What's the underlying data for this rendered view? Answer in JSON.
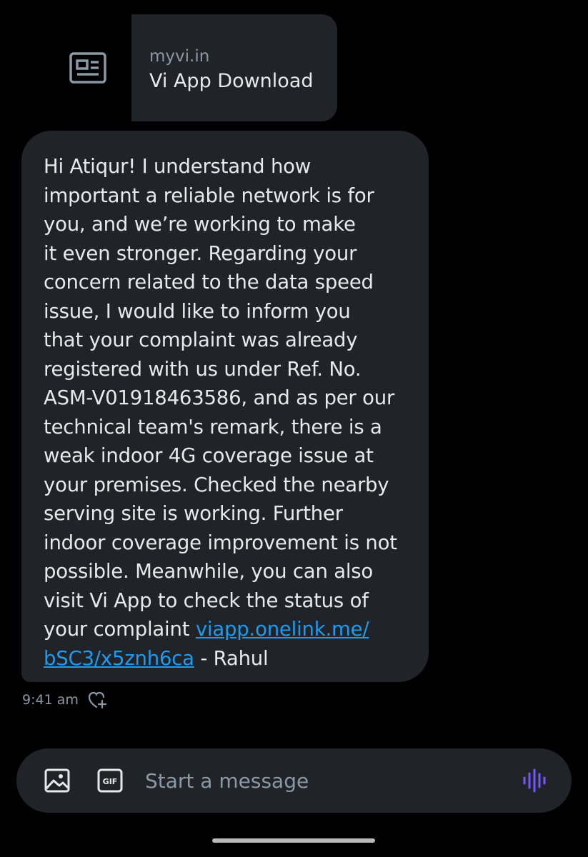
{
  "link_preview": {
    "domain": "myvi.in",
    "title": "Vi App Download",
    "icon": "article-icon"
  },
  "message": {
    "text_before_link": "Hi Atiqur! I understand how\nimportant a reliable network is for\nyou, and we’re working to make\nit even stronger. Regarding your\nconcern related to the data speed\nissue, I would like to inform you\nthat your complaint was already\nregistered with us under Ref. No.\nASM-V01918463586, and as per our\ntechnical team's remark, there is a\nweak indoor 4G coverage issue at\nyour premises. Checked the nearby\nserving site is working. Further\nindoor coverage improvement is not\npossible. Meanwhile, you can also\nvisit Vi App to check the status of\nyour complaint ",
    "link_text": "viapp.onelink.me/\nbSC3/x5znh6ca",
    "text_after_link": " - Rahul",
    "timestamp": "9:41 am",
    "reaction_icon": "heart-add-icon"
  },
  "composer": {
    "placeholder": "Start a message",
    "media_icon": "image-icon",
    "gif_icon": "gif-icon",
    "voice_icon": "audio-wave-icon"
  },
  "colors": {
    "background": "#000000",
    "bubble": "#202327",
    "text": "#e7e9ea",
    "muted": "#8b98a5",
    "link": "#1d9bf0",
    "voice_accent": "#7856ff"
  }
}
